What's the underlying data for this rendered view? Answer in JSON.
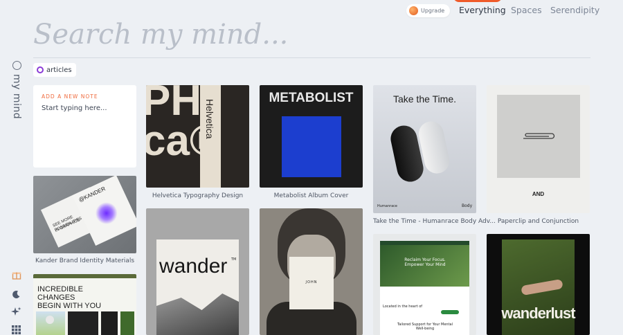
{
  "nav": {
    "upgrade_label": "Upgrade",
    "tabs": [
      "Everything",
      "Spaces",
      "Serendipity"
    ],
    "active_tab": "Everything"
  },
  "search": {
    "placeholder": "Search my mind..."
  },
  "sidebar": {
    "brand": "my mind",
    "icons": [
      "gift-icon",
      "moon-icon",
      "sparkle-icon",
      "grid-icon"
    ]
  },
  "filter": {
    "label": "articles"
  },
  "note": {
    "label": "ADD A NEW NOTE",
    "placeholder": "Start typing here..."
  },
  "cards": {
    "helvetica": {
      "caption": "Helvetica Typography Design",
      "big_text": "PH ca®",
      "side_text": "Helvetica"
    },
    "metabolist": {
      "caption": "Metabolist Album Cover",
      "title": "METABOLIST"
    },
    "humanrace": {
      "caption": "Take the Time - Humanrace Body Adv...",
      "title": "Take the Time.",
      "footer_left": "Humanrace",
      "footer_right": "Body"
    },
    "paperclip": {
      "caption": "Paperclip and Conjunction",
      "word": "AND"
    },
    "kander": {
      "caption": "Kander Brand Identity Materials",
      "brand": "@KANDER",
      "tagline": "SEE MORE POSSIBILITIES",
      "tagline2": "IN GRAPHICS"
    },
    "wander": {
      "title": "wander",
      "tm": "TM"
    },
    "portrait": {
      "name": "JOHN"
    },
    "wellbeing": {
      "hero": "Reclaim Your Focus. Empower Your Mind",
      "lead": "Located in the heart of",
      "sub": "Tailored Support for Your Mental Well-being"
    },
    "wanderlust": {
      "title": "wanderlust"
    },
    "changes": {
      "line1": "INCREDIBLE",
      "line2": "CHANGES",
      "line3": "BEGIN WITH YOU"
    }
  },
  "colors": {
    "accent": "#ef5b2a",
    "filter_ring": "#8a3bd6",
    "background": "#edf0f4"
  }
}
